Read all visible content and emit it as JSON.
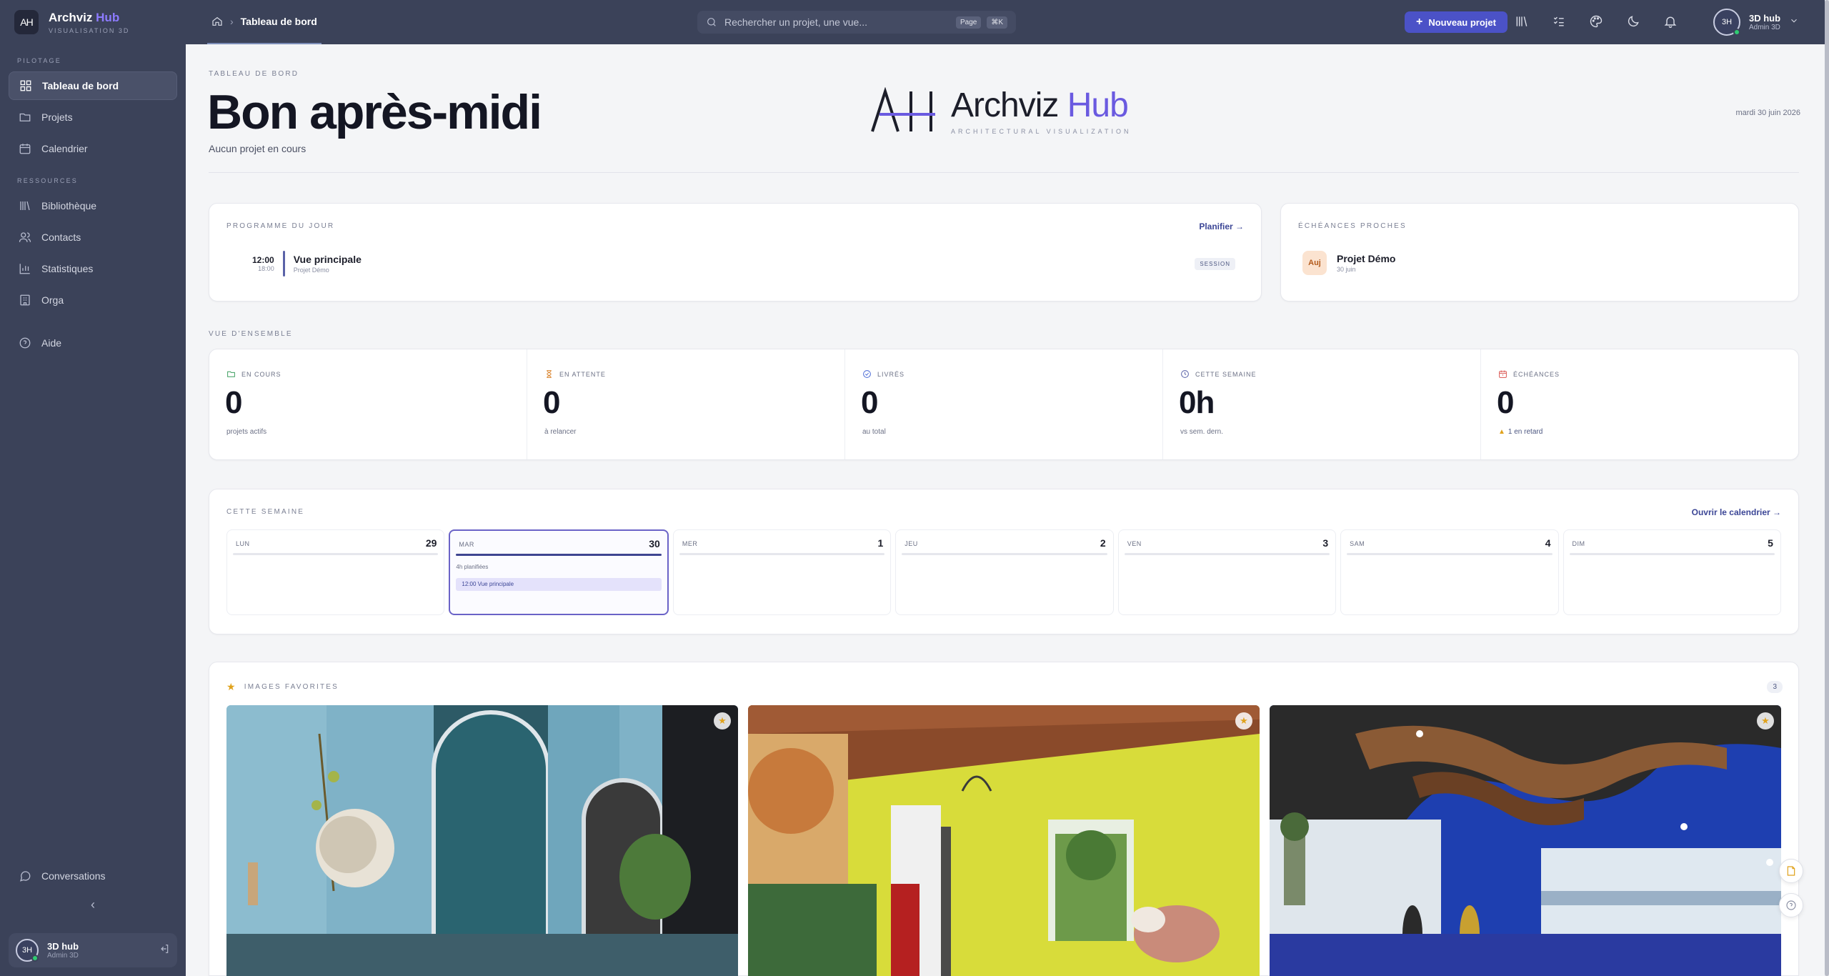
{
  "brand": {
    "logo": "AH",
    "name_main": "Archviz",
    "name_accent": "Hub",
    "subtitle": "VISUALISATION 3D"
  },
  "sidebar": {
    "sections": [
      {
        "label": "PILOTAGE"
      },
      {
        "label": "RESSOURCES"
      }
    ],
    "items": [
      {
        "label": "Tableau de bord",
        "icon": "grid-icon"
      },
      {
        "label": "Projets",
        "icon": "folder-icon"
      },
      {
        "label": "Calendrier",
        "icon": "calendar-icon"
      },
      {
        "label": "Bibliothèque",
        "icon": "library-icon"
      },
      {
        "label": "Contacts",
        "icon": "users-icon"
      },
      {
        "label": "Statistiques",
        "icon": "chart-icon"
      },
      {
        "label": "Orga",
        "icon": "building-icon"
      },
      {
        "label": "Aide",
        "icon": "help-icon"
      },
      {
        "label": "Conversations",
        "icon": "chat-icon"
      }
    ],
    "collapse_glyph": "‹",
    "user": {
      "initials": "3H",
      "name": "3D hub",
      "role": "Admin 3D"
    }
  },
  "topbar": {
    "breadcrumb": "Tableau de bord",
    "search_placeholder": "Rechercher un projet, une vue...",
    "kbd_page": "Page",
    "kbd_shortcut": "⌘K",
    "new_project": "Nouveau projet",
    "user": {
      "initials": "3H",
      "name": "3D hub",
      "role": "Admin 3D"
    }
  },
  "hero": {
    "eyebrow": "TABLEAU DE BORD",
    "greeting": "Bon après-midi",
    "subtitle": "Aucun projet en cours",
    "date": "mardi 30 juin 2026",
    "logo_mark": "AH",
    "logo_name_main": "Archviz",
    "logo_name_accent": "Hub",
    "logo_tagline": "ARCHITECTURAL VISUALIZATION"
  },
  "schedule": {
    "title": "PROGRAMME DU JOUR",
    "link": "Planifier →",
    "item": {
      "start": "12:00",
      "end": "18:00",
      "name": "Vue principale",
      "project": "Projet Démo",
      "badge": "SESSION"
    }
  },
  "deadlines": {
    "title": "ÉCHÉANCES PROCHES",
    "item": {
      "badge": "Auj",
      "name": "Projet Démo",
      "date": "30 juin"
    }
  },
  "overview": {
    "title": "VUE D'ENSEMBLE",
    "kpis": [
      {
        "label": "EN COURS",
        "value": "0",
        "note": "projets actifs",
        "color": "#3a9d5d"
      },
      {
        "label": "EN ATTENTE",
        "value": "0",
        "note": "à relancer",
        "color": "#d9822b"
      },
      {
        "label": "LIVRÉS",
        "value": "0",
        "note": "au total",
        "color": "#4b6bd6"
      },
      {
        "label": "CETTE SEMAINE",
        "value": "0h",
        "note": "vs sem. dern.",
        "color": "#5a62a8"
      },
      {
        "label": "ÉCHÉANCES",
        "value": "0",
        "note": "1 en retard",
        "color": "#d9534f"
      }
    ]
  },
  "week": {
    "title": "CETTE SEMAINE",
    "link": "Ouvrir le calendrier →",
    "days": [
      {
        "name": "LUN",
        "num": "29"
      },
      {
        "name": "MAR",
        "num": "30",
        "planned": "4h planifiées",
        "event": "12:00 Vue principale"
      },
      {
        "name": "MER",
        "num": "1"
      },
      {
        "name": "JEU",
        "num": "2"
      },
      {
        "name": "VEN",
        "num": "3"
      },
      {
        "name": "SAM",
        "num": "4"
      },
      {
        "name": "DIM",
        "num": "5"
      }
    ]
  },
  "favorites": {
    "title": "IMAGES FAVORITES",
    "count": "3"
  },
  "colors": {
    "sidebar": "#3b4259",
    "accent": "#4b52c7",
    "brand_accent": "#6a5ae0"
  }
}
